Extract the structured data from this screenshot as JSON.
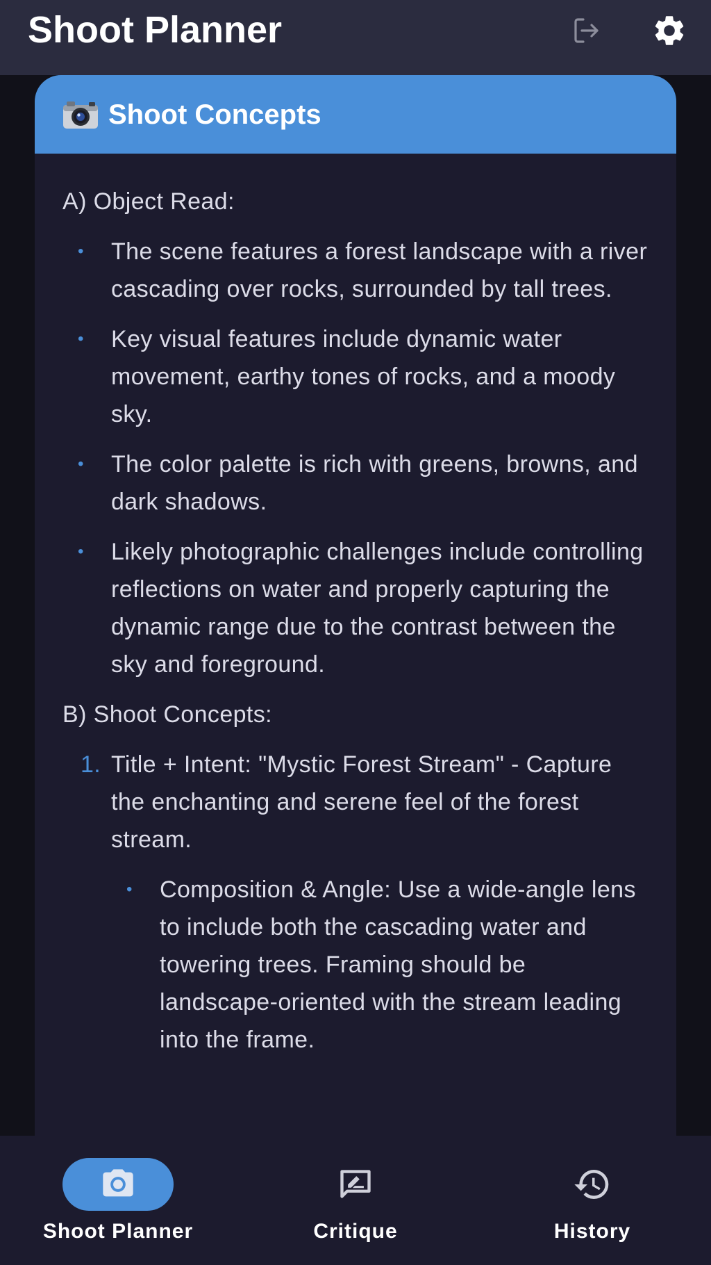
{
  "app_bar": {
    "title": "Shoot Planner",
    "actions": [
      "logout-icon",
      "gear-icon"
    ]
  },
  "card": {
    "header_icon": "camera-emoji",
    "header_title": "Shoot Concepts",
    "section_a": {
      "heading": "A) Object Read:",
      "bullets": [
        "The scene features a forest landscape with a river cascading over rocks, surrounded by tall trees.",
        "Key visual features include dynamic water movement, earthy tones of rocks, and a moody sky.",
        "The color palette is rich with greens, browns, and dark shadows.",
        "Likely photographic challenges include controlling reflections on water and properly capturing the dynamic range due to the contrast between the sky and foreground."
      ]
    },
    "section_b": {
      "heading": "B) Shoot Concepts:",
      "concepts": [
        {
          "number": "1.",
          "text": "Title + Intent: \"Mystic Forest Stream\" - Capture the enchanting and serene feel of the forest stream.",
          "sub_bullets": [
            "Composition & Angle: Use a wide-angle lens to include both the cascading water and towering trees. Framing should be landscape-oriented with the stream leading into the frame."
          ]
        }
      ]
    }
  },
  "bottom_nav": {
    "items": [
      {
        "label": "Shoot Planner",
        "icon": "camera-icon",
        "active": true
      },
      {
        "label": "Critique",
        "icon": "rate-review-icon",
        "active": false
      },
      {
        "label": "History",
        "icon": "history-icon",
        "active": false
      }
    ]
  },
  "colors": {
    "app_bar_bg": "#2b2c3f",
    "page_bg": "#111119",
    "card_bg": "#1c1b2e",
    "accent": "#4a8fd9",
    "text": "#dcdce8"
  }
}
